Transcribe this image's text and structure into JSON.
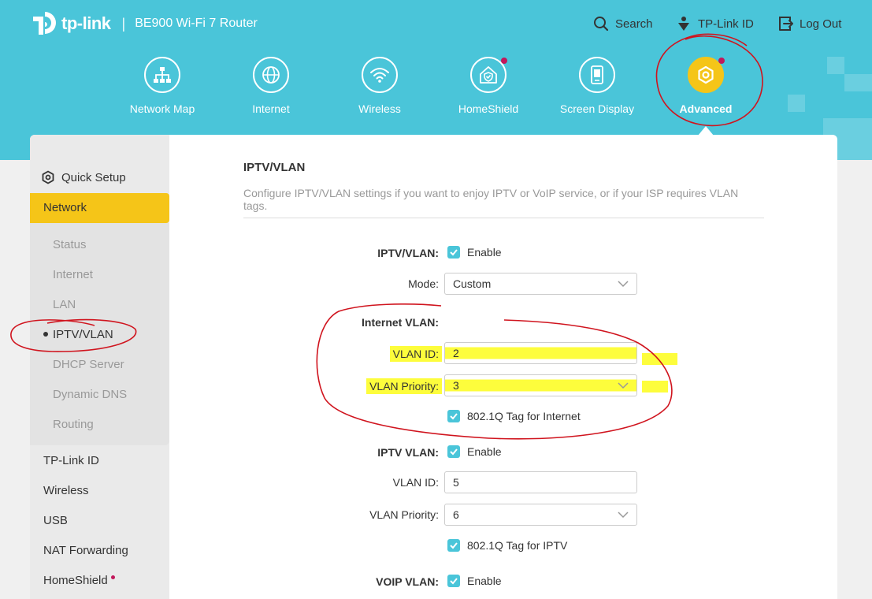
{
  "header": {
    "brand": "tp-link",
    "separator": "|",
    "model": "BE900 Wi-Fi 7 Router",
    "links": [
      {
        "label": "Search",
        "icon": "search-icon"
      },
      {
        "label": "TP-Link ID",
        "icon": "tplink-id-icon"
      },
      {
        "label": "Log Out",
        "icon": "logout-icon"
      }
    ]
  },
  "nav": [
    {
      "label": "Network Map",
      "icon": "network-map-icon"
    },
    {
      "label": "Internet",
      "icon": "globe-icon"
    },
    {
      "label": "Wireless",
      "icon": "wifi-icon"
    },
    {
      "label": "HomeShield",
      "icon": "homeshield-icon",
      "notification": true
    },
    {
      "label": "Screen Display",
      "icon": "screen-display-icon"
    },
    {
      "label": "Advanced",
      "icon": "gear-icon",
      "active": true,
      "notification": true
    }
  ],
  "sidebar": {
    "quick_setup": "Quick Setup",
    "active_section": "Network",
    "subitems": [
      "Status",
      "Internet",
      "LAN",
      "IPTV/VLAN",
      "DHCP Server",
      "Dynamic DNS",
      "Routing"
    ],
    "current_subitem": "IPTV/VLAN",
    "items": [
      "TP-Link ID",
      "Wireless",
      "USB",
      "NAT Forwarding",
      "HomeShield"
    ]
  },
  "page": {
    "title": "IPTV/VLAN",
    "description": "Configure IPTV/VLAN settings if you want to enjoy IPTV or VoIP service, or if your ISP requires VLAN tags."
  },
  "form": {
    "iptv_vlan": {
      "label": "IPTV/VLAN:",
      "checkbox_label": "Enable",
      "checked": true
    },
    "mode": {
      "label": "Mode:",
      "value": "Custom"
    },
    "internet_vlan": {
      "heading": "Internet VLAN:",
      "vlan_id_label": "VLAN ID:",
      "vlan_id": "2",
      "priority_label": "VLAN Priority:",
      "priority": "3",
      "tag_label": "802.1Q Tag for Internet",
      "tag_checked": true
    },
    "iptv_vlan_section": {
      "label": "IPTV VLAN:",
      "checkbox_label": "Enable",
      "checked": true,
      "vlan_id_label": "VLAN ID:",
      "vlan_id": "5",
      "priority_label": "VLAN Priority:",
      "priority": "6",
      "tag_label": "802.1Q Tag for IPTV",
      "tag_checked": true
    },
    "voip_vlan": {
      "label": "VOIP VLAN:",
      "checkbox_label": "Enable",
      "checked": true
    }
  },
  "colors": {
    "header_bg": "#4ac5d9",
    "accent_yellow": "#f5c518",
    "notification_dot": "#c2185b",
    "highlighter": "#fdfd3c",
    "annotation_red": "#d0141e"
  }
}
